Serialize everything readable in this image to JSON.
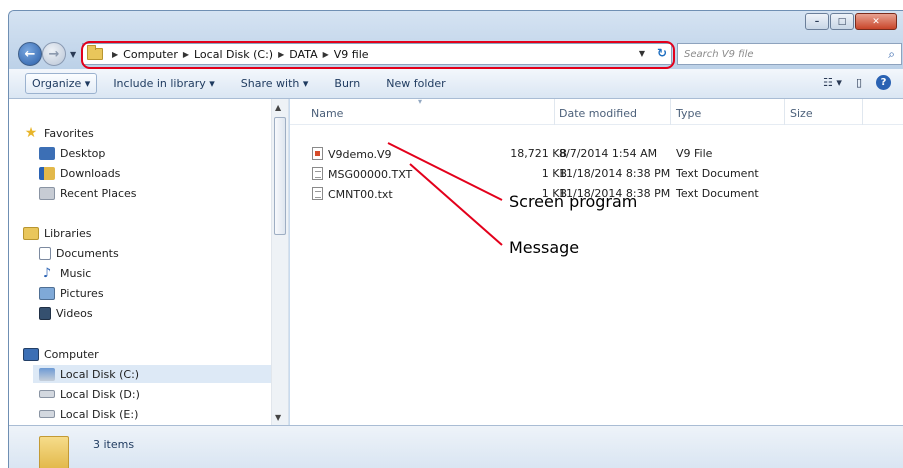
{
  "window": {
    "controls": {
      "minimize": "–",
      "maximize": "□",
      "close": "✕"
    }
  },
  "address_bar": {
    "breadcrumbs": [
      "Computer",
      "Local Disk (C:)",
      "DATA",
      "V9 file"
    ]
  },
  "search": {
    "placeholder": "Search V9 file"
  },
  "toolbar": {
    "organize": "Organize ▾",
    "include_in_library": "Include in library ▾",
    "share_with": "Share with ▾",
    "burn": "Burn",
    "new_folder": "New folder"
  },
  "navigation": {
    "favorites": "Favorites",
    "desktop": "Desktop",
    "downloads": "Downloads",
    "recent_places": "Recent Places",
    "libraries": "Libraries",
    "documents": "Documents",
    "music": "Music",
    "pictures": "Pictures",
    "videos": "Videos",
    "computer": "Computer",
    "local_c": "Local Disk (C:)",
    "local_d": "Local Disk (D:)",
    "local_e": "Local Disk (E:)"
  },
  "columns": {
    "name": "Name",
    "date_modified": "Date modified",
    "type": "Type",
    "size": "Size"
  },
  "files": [
    {
      "name": "V9demo.V9",
      "date": "8/7/2014 1:54 AM",
      "type": "V9 File",
      "size": "18,721 KB"
    },
    {
      "name": "MSG00000.TXT",
      "date": "11/18/2014 8:38 PM",
      "type": "Text Document",
      "size": "1 KB"
    },
    {
      "name": "CMNT00.txt",
      "date": "11/18/2014 8:38 PM",
      "type": "Text Document",
      "size": "1 KB"
    }
  ],
  "status": {
    "items": "3 items"
  },
  "annotations": {
    "screen_program": "Screen program",
    "message": "Message"
  },
  "colors": {
    "highlight": "#e3001b",
    "annotation_line": "#e3001b"
  }
}
